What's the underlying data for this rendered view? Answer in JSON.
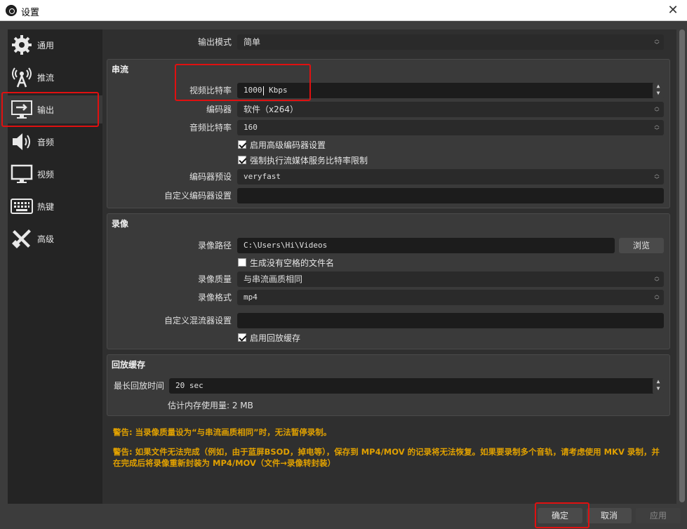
{
  "window": {
    "title": "设置"
  },
  "sidebar": {
    "items": [
      {
        "label": "通用",
        "icon": "gear-icon"
      },
      {
        "label": "推流",
        "icon": "broadcast-tower-icon"
      },
      {
        "label": "输出",
        "icon": "output-monitor-icon"
      },
      {
        "label": "音频",
        "icon": "speaker-icon"
      },
      {
        "label": "视频",
        "icon": "monitor-icon"
      },
      {
        "label": "热键",
        "icon": "keyboard-icon"
      },
      {
        "label": "高级",
        "icon": "tools-icon"
      }
    ]
  },
  "output_mode": {
    "label": "输出模式",
    "value": "简单"
  },
  "streaming": {
    "title": "串流",
    "video_bitrate": {
      "label": "视频比特率",
      "value_pre": "1000",
      "value_post": " Kbps"
    },
    "encoder": {
      "label": "编码器",
      "value": "软件（x264）"
    },
    "audio_bitrate": {
      "label": "音频比特率",
      "value": "160"
    },
    "check_advanced": {
      "label": "启用高级编码器设置",
      "checked": true
    },
    "check_enforce": {
      "label": "强制执行流媒体服务比特率限制",
      "checked": true
    },
    "preset": {
      "label": "编码器预设",
      "value": "veryfast"
    },
    "custom_settings": {
      "label": "自定义编码器设置",
      "value": ""
    }
  },
  "recording": {
    "title": "录像",
    "path": {
      "label": "录像路径",
      "value": "C:\\Users\\Hi\\Videos",
      "browse": "浏览"
    },
    "no_space": {
      "label": "生成没有空格的文件名",
      "checked": false
    },
    "quality": {
      "label": "录像质量",
      "value": "与串流画质相同"
    },
    "format": {
      "label": "录像格式",
      "value": "mp4"
    },
    "muxer": {
      "label": "自定义混流器设置",
      "value": ""
    },
    "replay": {
      "label": "启用回放缓存",
      "checked": true
    }
  },
  "replay_buffer": {
    "title": "回放缓存",
    "max_time": {
      "label": "最长回放时间",
      "value": "20 sec"
    },
    "memory": "估计内存使用量: 2 MB"
  },
  "warnings": [
    "警告: 当录像质量设为“与串流画质相同”时，无法暂停录制。",
    "警告: 如果文件无法完成（例如，由于蓝屏BSOD，掉电等），保存到 MP4/MOV 的记录将无法恢复。如果要录制多个音轨，请考虑使用 MKV 录制，并在完成后将录像重新封装为 MP4/MOV（文件→录像转封装）"
  ],
  "footer": {
    "ok": "确定",
    "cancel": "取消",
    "apply": "应用"
  },
  "colors": {
    "highlight": "#e01010",
    "warning": "#e0a000"
  }
}
